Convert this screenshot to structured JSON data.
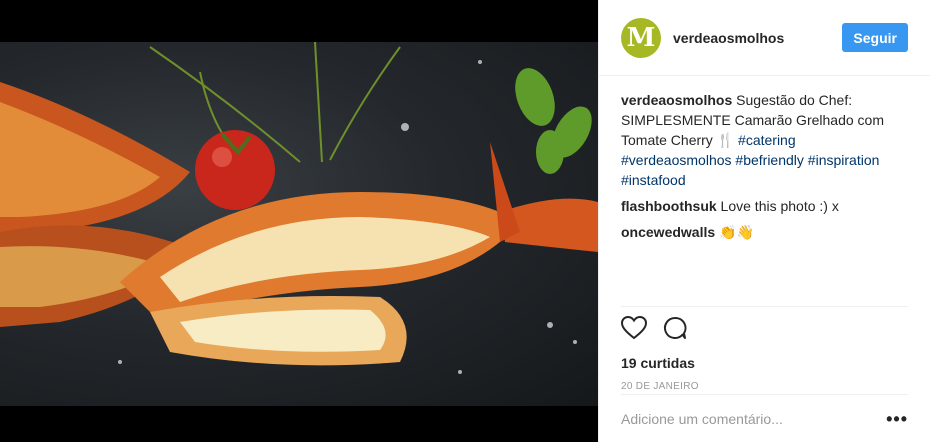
{
  "post": {
    "username": "verdeaosmolhos",
    "avatar_letter": "M",
    "follow_label": "Seguir",
    "caption": {
      "user": "verdeaosmolhos",
      "text": " Sugestão do Chef: SIMPLESMENTE Camarão Grelhado com Tomate Cherry 🍴 ",
      "tags": [
        "#catering",
        "#verdeaosmolhos",
        "#befriendly",
        "#inspiration",
        "#instafood"
      ]
    },
    "comments": [
      {
        "user": "flashboothsuk",
        "text": " Love this photo :) x"
      },
      {
        "user": "oncewedwalls",
        "text": " 👏👋"
      }
    ],
    "likes": "19 curtidas",
    "date": "20 DE JANEIRO",
    "add_comment_placeholder": "Adicione um comentário...",
    "more_label": "•••"
  },
  "icons": {
    "like": "heart-icon",
    "comment": "comment-icon"
  },
  "colors": {
    "accent": "#3897f0",
    "hashtag": "#003569",
    "avatar": "#a7b825"
  }
}
